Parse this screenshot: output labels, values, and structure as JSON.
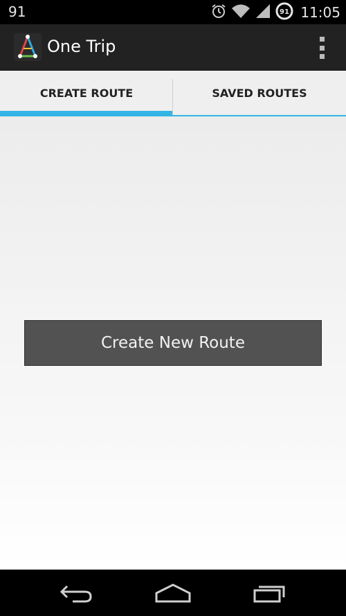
{
  "status_bar": {
    "battery_level_left": "91",
    "battery_badge": "91",
    "time": "11:05",
    "icons": [
      "alarm-icon",
      "wifi-icon",
      "signal-icon",
      "battery-icon"
    ]
  },
  "action_bar": {
    "title": "One Trip",
    "logo_icon": "app-logo-icon",
    "overflow_icon": "overflow-menu-icon"
  },
  "tabs": [
    {
      "label": "CREATE ROUTE",
      "selected": true
    },
    {
      "label": "SAVED ROUTES",
      "selected": false
    }
  ],
  "main": {
    "create_button_label": "Create New Route"
  },
  "nav_bar": {
    "icons": [
      "back-icon",
      "home-icon",
      "recent-apps-icon"
    ]
  },
  "colors": {
    "accent": "#33b5e5",
    "action_bar": "#222222",
    "button": "#525252"
  }
}
